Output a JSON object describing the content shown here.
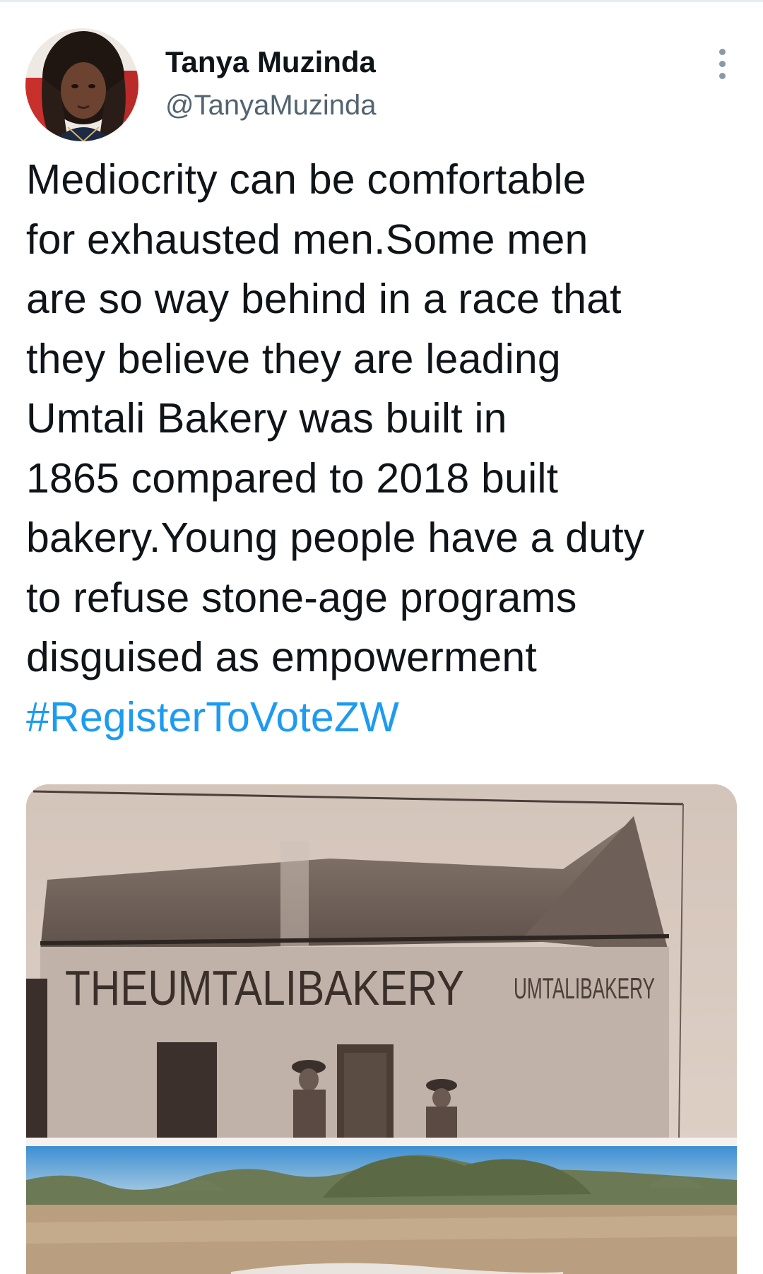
{
  "author": {
    "display_name": "Tanya Muzinda",
    "handle": "@TanyaMuzinda",
    "avatar_icon": "profile-photo"
  },
  "more_icon": "more-vertical-icon",
  "tweet": {
    "lines": [
      "Mediocrity can be comfortable",
      "for exhausted men.Some men",
      "are so way behind in a race that",
      "they believe they are leading",
      "Umtali Bakery was built in",
      "1865 compared to 2018 built",
      "bakery.Young people have a duty",
      "to refuse stone-age programs",
      "disguised as empowerment"
    ],
    "hashtag": "#RegisterToVoteZW"
  },
  "media": {
    "sign_main": "THEUMTALIBAKERY",
    "sign_side": "UMTALIBAKERY"
  },
  "colors": {
    "link": "#1d9bf0",
    "text": "#0f1419",
    "secondary": "#536471"
  }
}
